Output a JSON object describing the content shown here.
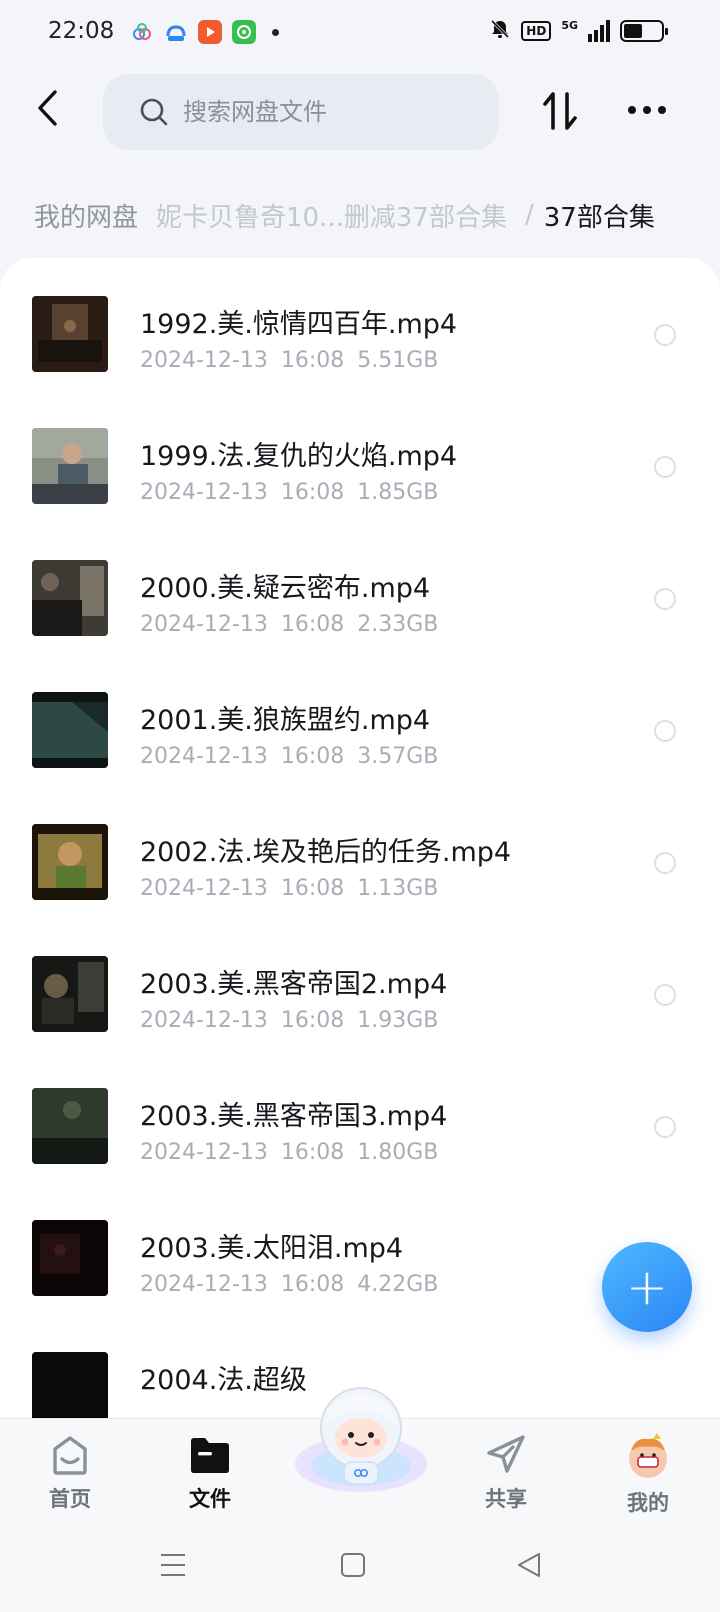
{
  "status_bar": {
    "time": "22:08",
    "hd": "HD",
    "network": "5G",
    "battery_level": 0.5
  },
  "header": {
    "search_placeholder": "搜索网盘文件",
    "back_icon": "back-arrow-icon",
    "sort_icon": "sort-icon",
    "more_icon": "more-icon"
  },
  "breadcrumb": {
    "root": "我的网盘",
    "middle": "妮卡贝鲁奇10...删减37部合集",
    "separator": "/",
    "current": "37部合集"
  },
  "files": [
    {
      "name": "1992.美.惊情四百年.mp4",
      "date": "2024-12-13",
      "time": "16:08",
      "size": "5.51GB"
    },
    {
      "name": "1999.法.复仇的火焰.mp4",
      "date": "2024-12-13",
      "time": "16:08",
      "size": "1.85GB"
    },
    {
      "name": "2000.美.疑云密布.mp4",
      "date": "2024-12-13",
      "time": "16:08",
      "size": "2.33GB"
    },
    {
      "name": "2001.美.狼族盟约.mp4",
      "date": "2024-12-13",
      "time": "16:08",
      "size": "3.57GB"
    },
    {
      "name": "2002.法.埃及艳后的任务.mp4",
      "date": "2024-12-13",
      "time": "16:08",
      "size": "1.13GB"
    },
    {
      "name": "2003.美.黑客帝国2.mp4",
      "date": "2024-12-13",
      "time": "16:08",
      "size": "1.93GB"
    },
    {
      "name": "2003.美.黑客帝国3.mp4",
      "date": "2024-12-13",
      "time": "16:08",
      "size": "1.80GB"
    },
    {
      "name": "2003.美.太阳泪.mp4",
      "date": "2024-12-13",
      "time": "16:08",
      "size": "4.22GB"
    },
    {
      "name": "2004.法.超级",
      "date": "",
      "time": "",
      "size": ""
    }
  ],
  "fab": {
    "label": "+"
  },
  "bottom_nav": {
    "home": "首页",
    "files": "文件",
    "share": "共享",
    "mine": "我的"
  },
  "colors": {
    "accent": "#2a86f5",
    "meta_text": "#a8adb6",
    "background": "#f3f5f8"
  }
}
